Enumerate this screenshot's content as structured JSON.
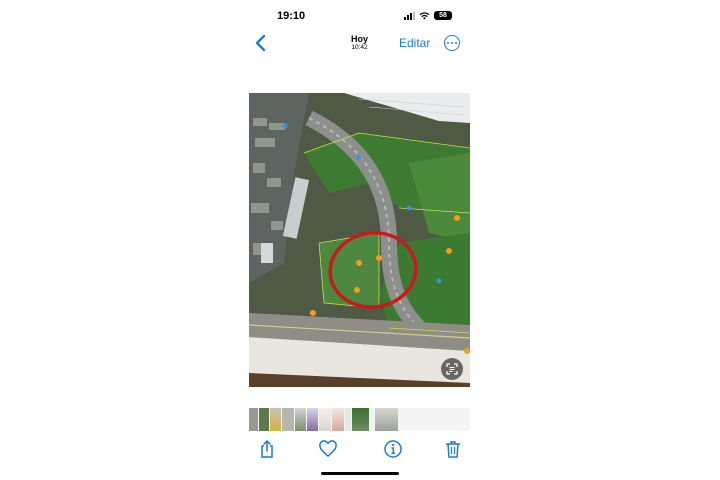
{
  "status_bar": {
    "time": "19:10",
    "battery": "58"
  },
  "nav": {
    "date_label": "Hoy",
    "time_label": "10:42",
    "edit_label": "Editar"
  },
  "icons": {
    "back": "chevron-left-icon",
    "more": "ellipsis-circle-icon",
    "live_text": "live-text-icon",
    "share": "share-icon",
    "favorite": "heart-icon",
    "info": "info-icon",
    "delete": "trash-icon"
  },
  "colors": {
    "accent": "#1f7ad8",
    "annotation_circle": "#c8191b"
  },
  "thumbnails_count": 11
}
